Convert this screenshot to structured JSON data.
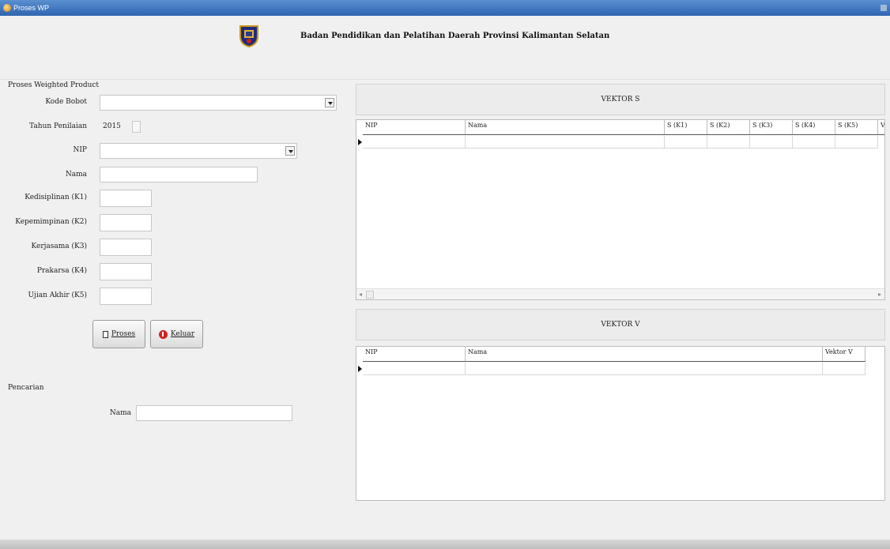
{
  "window": {
    "title": "Proses WP"
  },
  "header": {
    "org_name": "Badan Pendidikan dan Pelatihan Daerah Provinsi Kalimantan Selatan",
    "logo_icon": "provincial-emblem-icon"
  },
  "form": {
    "group_title": "Proses Weighted Product",
    "kode_bobot_label": "Kode Bobot",
    "kode_bobot_value": "",
    "tahun_label": "Tahun Penilaian",
    "tahun_value": "2015",
    "nip_label": "NIP",
    "nip_value": "",
    "nama_label": "Nama",
    "nama_value": "",
    "k1_label": "Kedisiplinan (K1)",
    "k2_label": "Kepemimpinan (K2)",
    "k3_label": "Kerjasama (K3)",
    "k4_label": "Prakarsa (K4)",
    "k5_label": "Ujian Akhir (K5)",
    "proses_button": "Proses",
    "keluar_button": "Keluar"
  },
  "search": {
    "group_title": "Pencarian",
    "nama_label": "Nama",
    "nama_value": ""
  },
  "vektor_s": {
    "title": "VEKTOR S",
    "columns": [
      "NIP",
      "Nama",
      "S (K1)",
      "S (K2)",
      "S (K3)",
      "S (K4)",
      "S (K5)",
      "Ve"
    ]
  },
  "vektor_v": {
    "title": "VEKTOR V",
    "columns": [
      "NIP",
      "Nama",
      "Vektor V"
    ]
  },
  "colors": {
    "titlebar": "#2f65b0",
    "window_bg": "#f0f0f0",
    "exit_icon": "#d21f1f"
  }
}
